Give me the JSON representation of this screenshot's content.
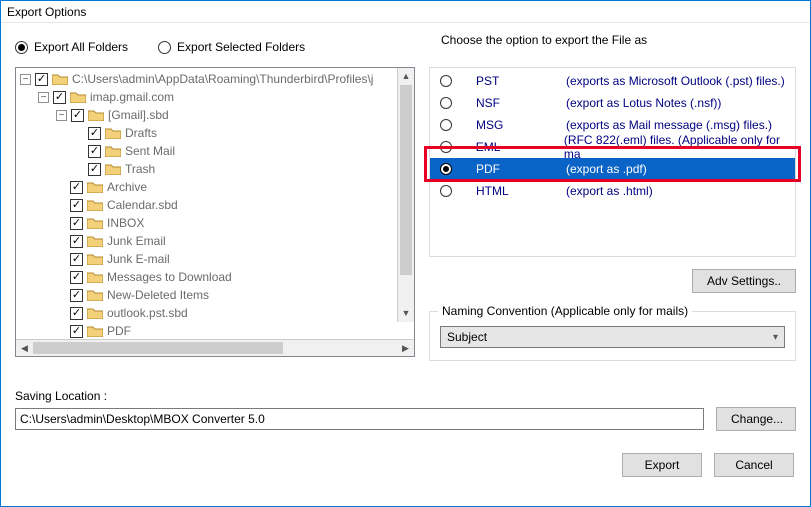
{
  "title": "Export Options",
  "radios": {
    "all": "Export All Folders",
    "selected": "Export Selected Folders"
  },
  "rightHeader": "Choose the option to export the File as",
  "tree": {
    "rootPath": "C:\\Users\\admin\\AppData\\Roaming\\Thunderbird\\Profiles\\j",
    "imap": "imap.gmail.com",
    "gmail": "[Gmail].sbd",
    "drafts": "Drafts",
    "sent": "Sent Mail",
    "trash": "Trash",
    "archive": "Archive",
    "calendar": "Calendar.sbd",
    "inbox": "INBOX",
    "junkEmail": "Junk Email",
    "junkEmail2": "Junk E-mail",
    "messagesDownload": "Messages to Download",
    "newDeleted": "New-Deleted Items",
    "outlookPst": "outlook.pst.sbd",
    "pdf": "PDF"
  },
  "formats": [
    {
      "name": "PST",
      "desc": "(exports as Microsoft Outlook (.pst) files.)"
    },
    {
      "name": "NSF",
      "desc": "(export as Lotus Notes (.nsf))"
    },
    {
      "name": "MSG",
      "desc": "(exports as Mail message (.msg) files.)"
    },
    {
      "name": "EML",
      "desc": "(RFC 822(.eml) files. (Applicable only for ma"
    },
    {
      "name": "PDF",
      "desc": "(export as .pdf)"
    },
    {
      "name": "HTML",
      "desc": "(export as .html)"
    }
  ],
  "advSettings": "Adv Settings..",
  "naming": {
    "legend": "Naming Convention (Applicable only for mails)",
    "value": "Subject"
  },
  "saving": {
    "label": "Saving Location :",
    "path": "C:\\Users\\admin\\Desktop\\MBOX Converter 5.0",
    "change": "Change..."
  },
  "buttons": {
    "export": "Export",
    "cancel": "Cancel"
  }
}
